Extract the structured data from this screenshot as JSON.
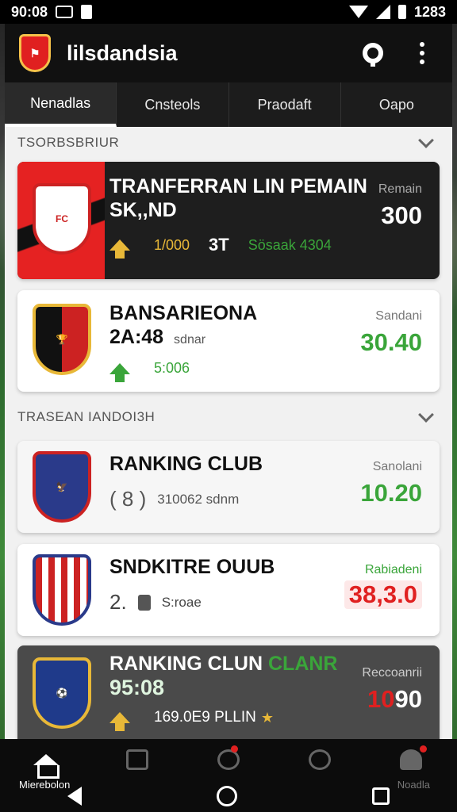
{
  "status_bar": {
    "time_left": "90:08",
    "time_right": "1283"
  },
  "header": {
    "title": "lilsdandsia",
    "logo_icon": "shield-logo-icon",
    "search_icon": "search-icon",
    "menu_icon": "more-vert-icon"
  },
  "tabs": [
    {
      "label": "Nenadlas",
      "active": true
    },
    {
      "label": "Cnsteols",
      "active": false
    },
    {
      "label": "Praodaft",
      "active": false
    },
    {
      "label": "Oapo",
      "active": false
    }
  ],
  "sections": [
    {
      "title": "TSORBSBRIUR"
    },
    {
      "title": "TRASEAN IANDOI3H"
    }
  ],
  "cards": [
    {
      "title_line1": "TRANFERRAN LIN PEMAIN",
      "title_line2": "SK,,ND",
      "right_label": "Remain",
      "right_value": "300",
      "stat_value": "1/000",
      "stat_extra": "3T",
      "stat_tag": "Sösaak 4304",
      "arrow_color": "#e8b838",
      "tag_color": "#3aa53a"
    },
    {
      "title_line1": "BANSARIEONA",
      "title_line2": "2A:48",
      "title_sub": "sdnar",
      "right_label": "Sandani",
      "right_value": "30.40",
      "stat_value": "5:006",
      "value_color": "#3aa53a"
    },
    {
      "title_line1": "RANKING CLUB",
      "stat_paren": "( 8 )",
      "stat_text": "310062 sdnm",
      "right_label": "Sanolani",
      "right_value": "10.20",
      "value_color": "#3aa53a"
    },
    {
      "title_line1": "SNDKITRE OUUB",
      "stat_num": "2.",
      "stat_text": "S:roae",
      "right_label": "Rabiadeni",
      "right_value": "38,3.0",
      "value_color": "#e02020"
    },
    {
      "title_line1": "RANKING CLUN",
      "title_accent": "CLANR",
      "title_line2": "95:08",
      "right_label": "Reccoanrii",
      "right_value_red": "10",
      "right_value_white": "90",
      "stat_text": "169.0E9 PLLIN",
      "star": "★"
    }
  ],
  "bottom_nav": {
    "items": [
      "home-icon",
      "store-icon",
      "target-icon",
      "face-icon",
      "profile-icon"
    ],
    "left_label": "Mierebolon",
    "right_label": "Noadla"
  }
}
